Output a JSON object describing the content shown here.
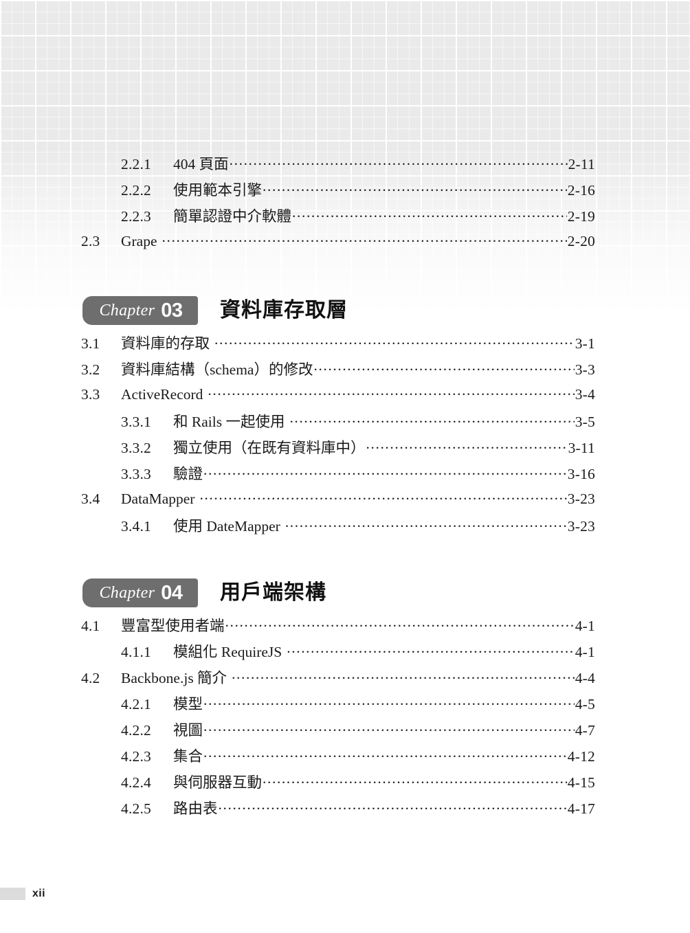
{
  "page": {
    "footer_page_number": "xii",
    "background": "faded-plaid-grid",
    "badge_color": "#6e6e6e",
    "text_color": "#1a1a1a"
  },
  "toc": {
    "continued_section": {
      "entries": [
        {
          "number": "2.2.1",
          "title": "404 頁面",
          "page": "2-11",
          "level": 3
        },
        {
          "number": "2.2.2",
          "title": "使用範本引擎",
          "page": "2-16",
          "level": 3
        },
        {
          "number": "2.2.3",
          "title": "簡單認證中介軟體",
          "page": "2-19",
          "level": 3
        },
        {
          "number": "2.3",
          "title": "Grape",
          "page": "2-20",
          "level": 2
        }
      ]
    },
    "chapters": [
      {
        "label": "Chapter",
        "number": "03",
        "title": "資料庫存取層",
        "entries": [
          {
            "number": "3.1",
            "title": "資料庫的存取",
            "page": "3-1",
            "level": 2
          },
          {
            "number": "3.2",
            "title": "資料庫結構（schema）的修改",
            "page": "3-3",
            "level": 2
          },
          {
            "number": "3.3",
            "title": "ActiveRecord",
            "page": "3-4",
            "level": 2
          },
          {
            "number": "3.3.1",
            "title": "和 Rails 一起使用",
            "page": "3-5",
            "level": 3
          },
          {
            "number": "3.3.2",
            "title": "獨立使用（在既有資料庫中）",
            "page": "3-11",
            "level": 3
          },
          {
            "number": "3.3.3",
            "title": "驗證",
            "page": "3-16",
            "level": 3
          },
          {
            "number": "3.4",
            "title": "DataMapper",
            "page": "3-23",
            "level": 2
          },
          {
            "number": "3.4.1",
            "title": "使用 DateMapper",
            "page": "3-23",
            "level": 3
          }
        ]
      },
      {
        "label": "Chapter",
        "number": "04",
        "title": "用戶端架構",
        "entries": [
          {
            "number": "4.1",
            "title": "豐富型使用者端",
            "page": "4-1",
            "level": 2
          },
          {
            "number": "4.1.1",
            "title": "模組化 RequireJS",
            "page": "4-1",
            "level": 3
          },
          {
            "number": "4.2",
            "title": "Backbone.js 簡介",
            "page": "4-4",
            "level": 2
          },
          {
            "number": "4.2.1",
            "title": "模型",
            "page": "4-5",
            "level": 3
          },
          {
            "number": "4.2.2",
            "title": "視圖",
            "page": "4-7",
            "level": 3
          },
          {
            "number": "4.2.3",
            "title": "集合",
            "page": "4-12",
            "level": 3
          },
          {
            "number": "4.2.4",
            "title": "與伺服器互動",
            "page": "4-15",
            "level": 3
          },
          {
            "number": "4.2.5",
            "title": "路由表",
            "page": "4-17",
            "level": 3
          }
        ]
      }
    ]
  }
}
